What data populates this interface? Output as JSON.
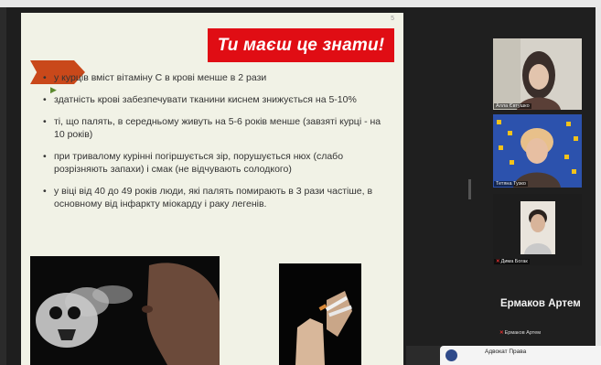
{
  "slide": {
    "page_number": "5",
    "banner": "Ти маєш це знати!",
    "bullets": [
      "у курців вміст вітаміну С в крові менше в 2 рази",
      "здатність крові забезпечувати тканини киснем знижується на 5-10%",
      "ті, що палять, в середньому живуть на 5-6 років менше (завзяті курці - на 10 років)",
      "при тривалому курінні погіршується зір, порушується нюх (слабо розрізняють запахи) і смак (не відчувають солодкого)",
      "у віці від 40 до 49 років люди, які палять помирають в 3 рази частіше, в основному від інфаркту міокарду і раку легенів."
    ]
  },
  "participants": [
    {
      "name": "Алла Євтушко",
      "muted": false
    },
    {
      "name": "Тетяна Тузко",
      "muted": false
    },
    {
      "name": "Дима Богак",
      "muted": true
    },
    {
      "name": "Ермаков Артем",
      "muted": true,
      "avatar_text": "Ермаков Артем"
    }
  ],
  "notification": {
    "text": "Адвокат Права"
  },
  "icons": {
    "mic_muted": "mic-off-icon"
  },
  "colors": {
    "banner": "#e00d14",
    "slide_bg": "#f1f2e6",
    "accent_arrow": "#c9481a"
  }
}
